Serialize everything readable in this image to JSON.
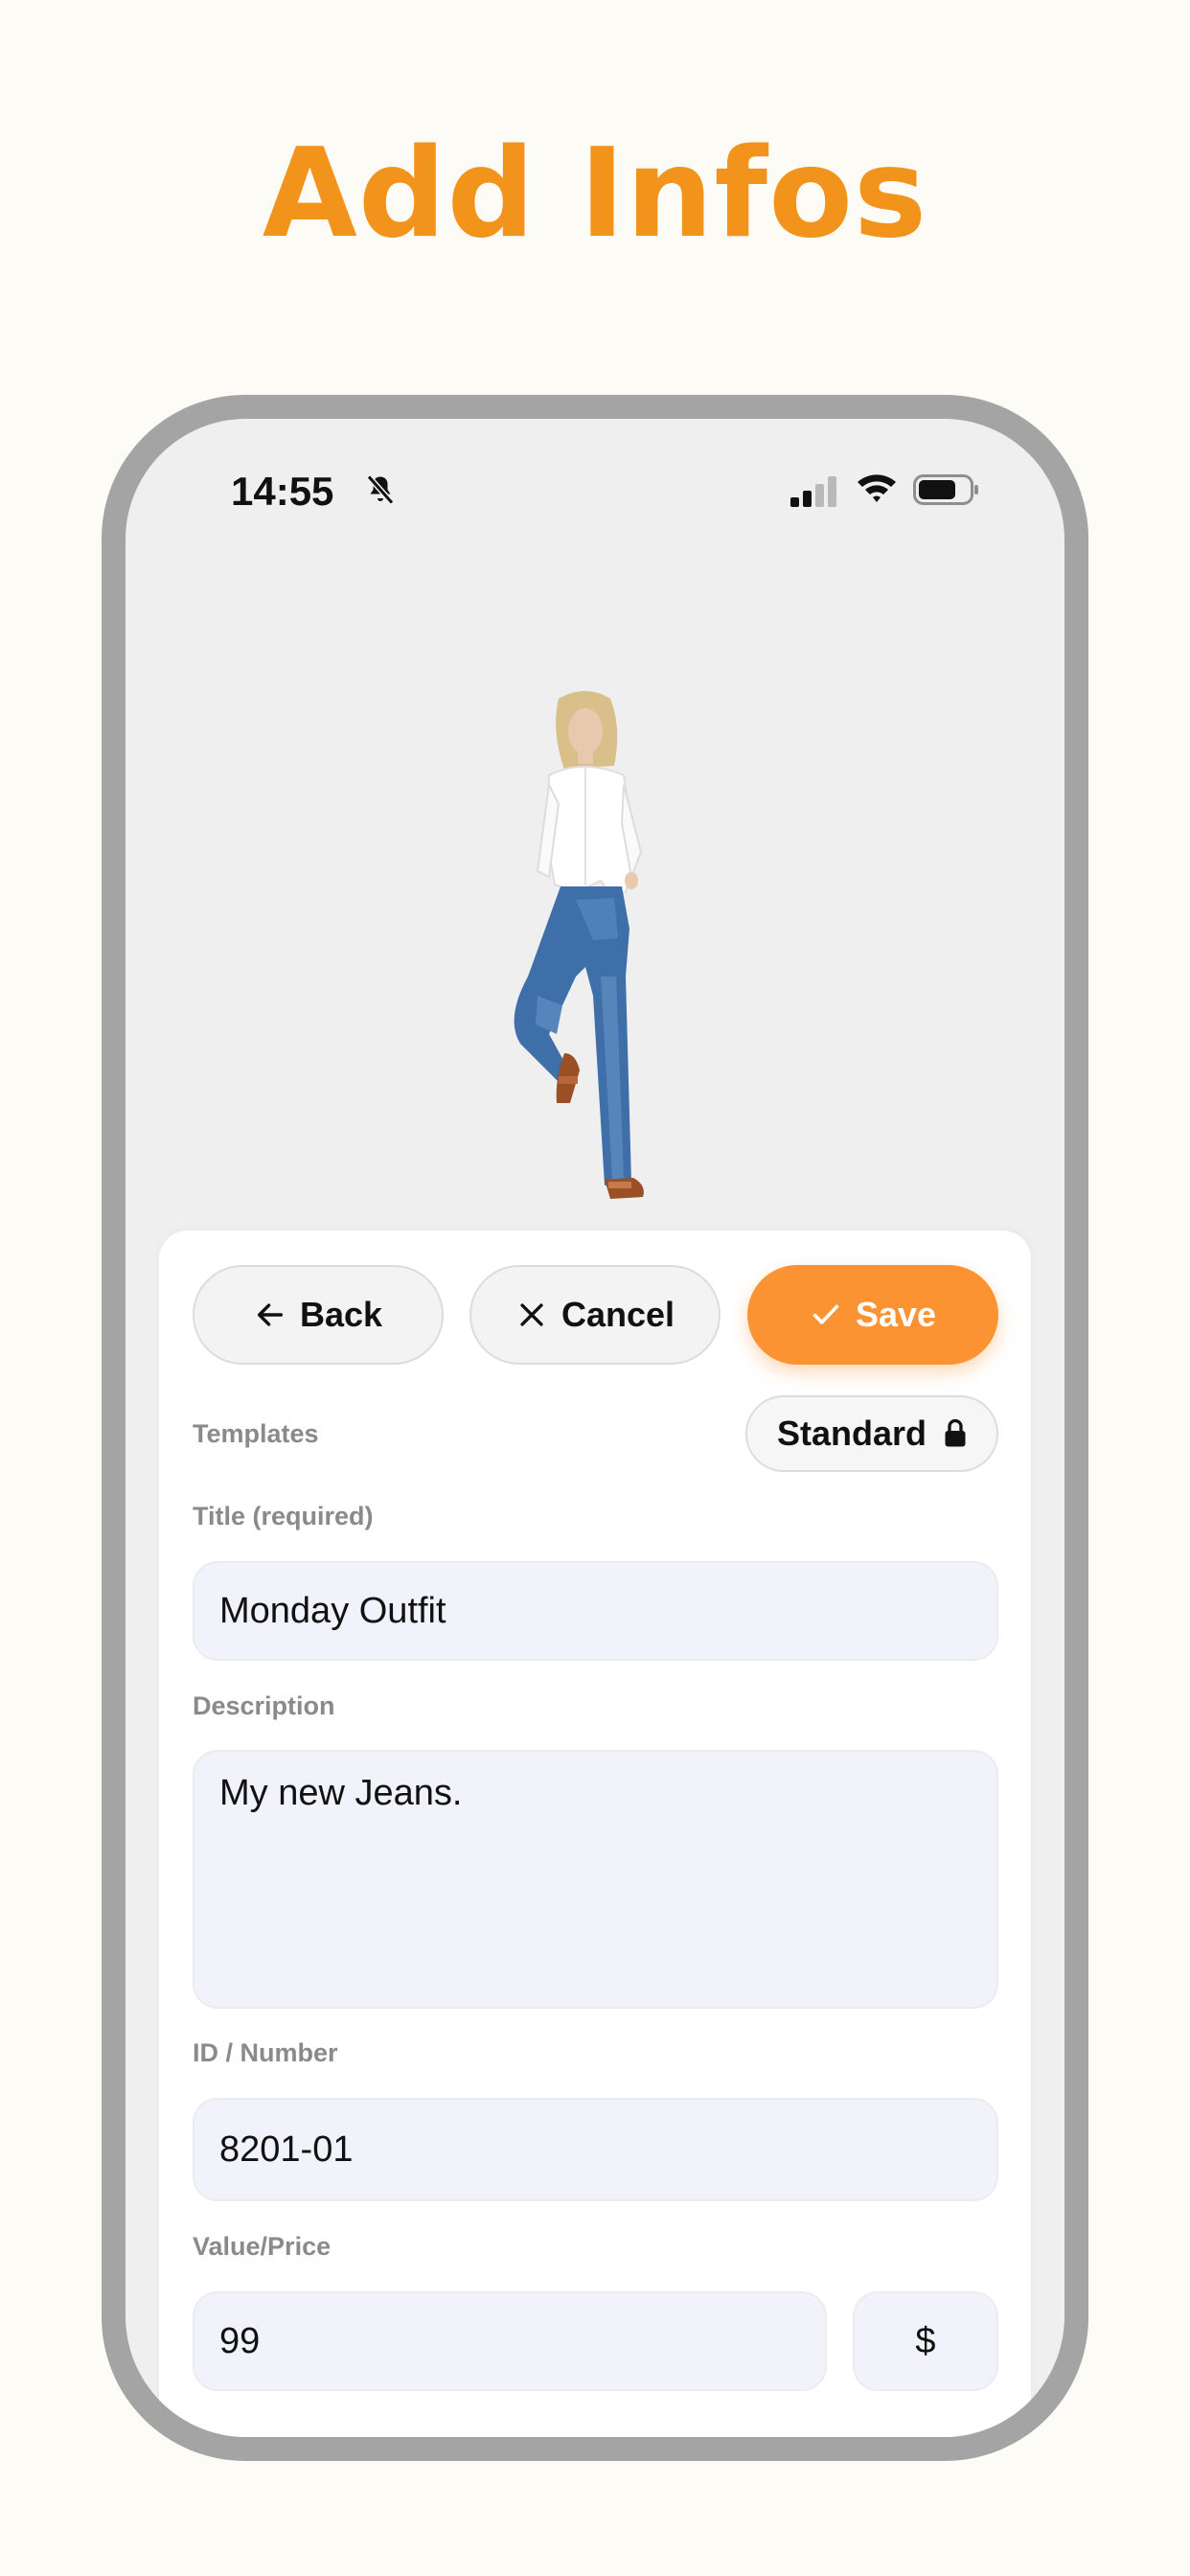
{
  "headline": "Add Infos",
  "status_bar": {
    "time": "14:55",
    "icons": [
      "bell-slash-icon",
      "cellular-signal-icon",
      "wifi-icon",
      "battery-icon"
    ]
  },
  "toolbar": {
    "back_label": "Back",
    "cancel_label": "Cancel",
    "save_label": "Save"
  },
  "templates": {
    "label": "Templates",
    "selected": "Standard"
  },
  "form": {
    "title_label": "Title (required)",
    "title_value": "Monday Outfit",
    "description_label": "Description",
    "description_value": "My new Jeans.",
    "id_label": "ID / Number",
    "id_value": "8201-01",
    "price_label": "Value/Price",
    "price_value": "99",
    "currency": "$"
  },
  "colors": {
    "accent": "#fb9333",
    "headline": "#f2931c",
    "background": "#fdfbf6",
    "phone_frame": "#a4a4a4",
    "field_bg": "#f1f2fa"
  }
}
